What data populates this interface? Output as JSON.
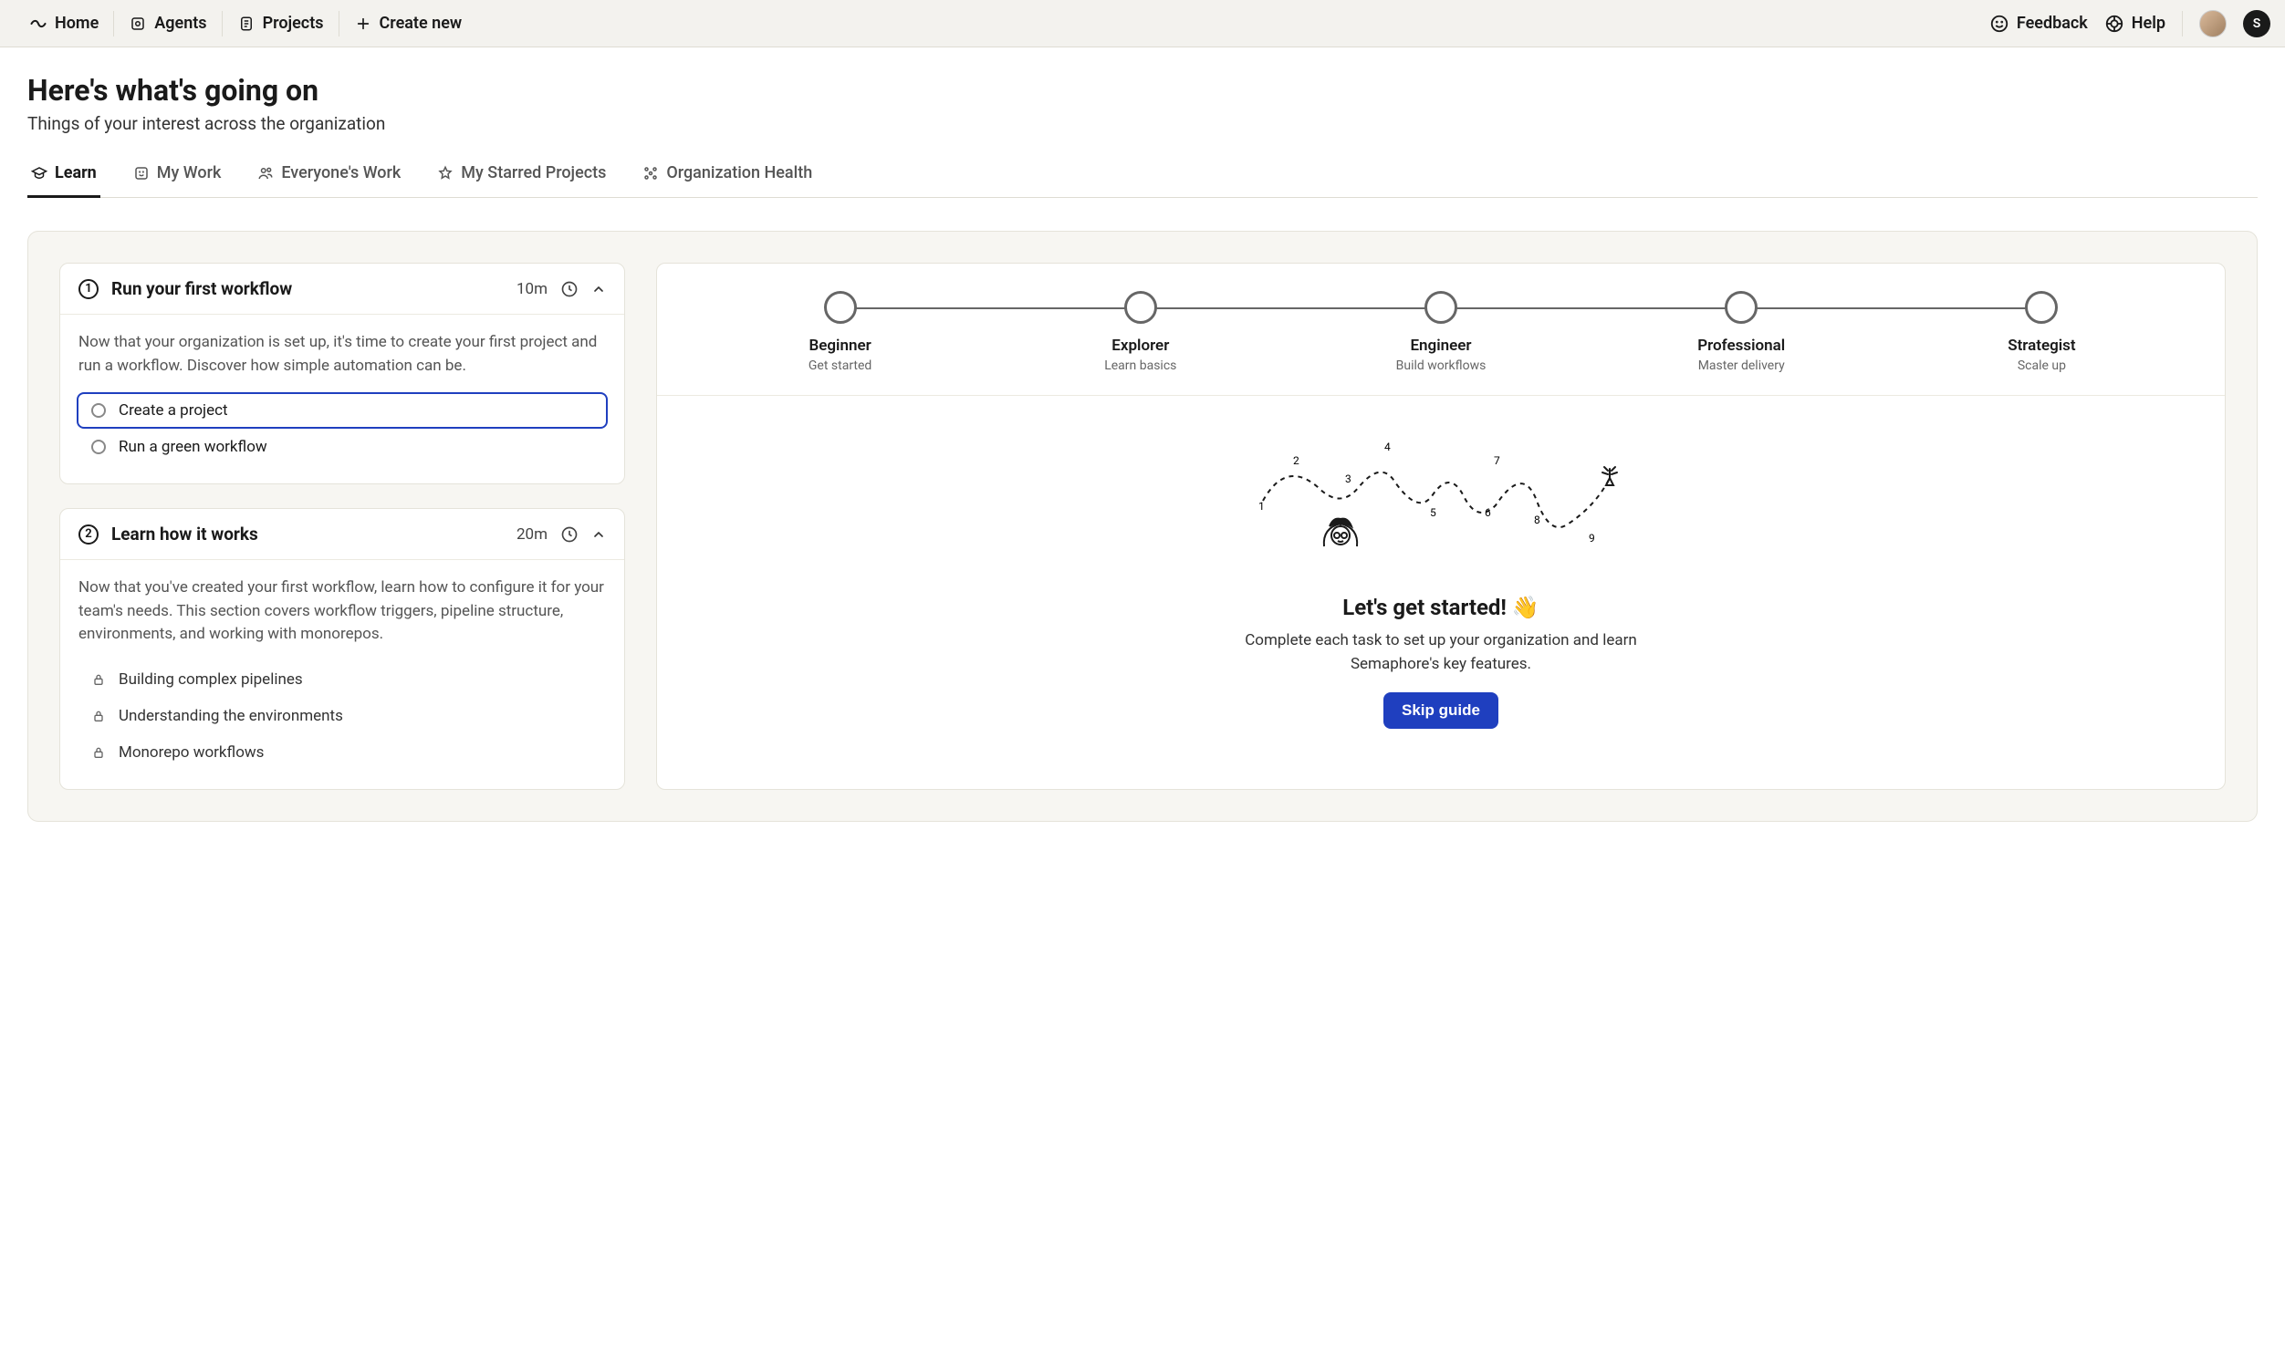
{
  "nav": {
    "home": "Home",
    "agents": "Agents",
    "projects": "Projects",
    "create": "Create new",
    "feedback": "Feedback",
    "help": "Help",
    "badge": "S"
  },
  "header": {
    "title": "Here's what's going on",
    "subtitle": "Things of your interest across the organization"
  },
  "tabs": [
    {
      "label": "Learn"
    },
    {
      "label": "My Work"
    },
    {
      "label": "Everyone's Work"
    },
    {
      "label": "My Starred Projects"
    },
    {
      "label": "Organization Health"
    }
  ],
  "lessons": [
    {
      "num": "1",
      "title": "Run your first workflow",
      "duration": "10m",
      "desc": "Now that your organization is set up, it's time to create your first project and run a workflow. Discover how simple automation can be.",
      "tasks": [
        {
          "label": "Create a project",
          "selected": true
        },
        {
          "label": "Run a green workflow",
          "selected": false
        }
      ]
    },
    {
      "num": "2",
      "title": "Learn how it works",
      "duration": "20m",
      "desc": "Now that you've created your first workflow, learn how to configure it for your team's needs. This section covers workflow triggers, pipeline structure, environments, and working with monorepos.",
      "locked_tasks": [
        "Building complex pipelines",
        "Understanding the environments",
        "Monorepo workflows"
      ]
    }
  ],
  "stages": [
    {
      "name": "Beginner",
      "desc": "Get started"
    },
    {
      "name": "Explorer",
      "desc": "Learn basics"
    },
    {
      "name": "Engineer",
      "desc": "Build workflows"
    },
    {
      "name": "Professional",
      "desc": "Master delivery"
    },
    {
      "name": "Strategist",
      "desc": "Scale up"
    }
  ],
  "guide": {
    "heading": "Let's get started! 👋",
    "body": "Complete each task to set up your organization and learn Semaphore's key features.",
    "skip": "Skip guide"
  },
  "journey_labels": [
    "1",
    "2",
    "3",
    "4",
    "5",
    "6",
    "7",
    "8",
    "9"
  ]
}
